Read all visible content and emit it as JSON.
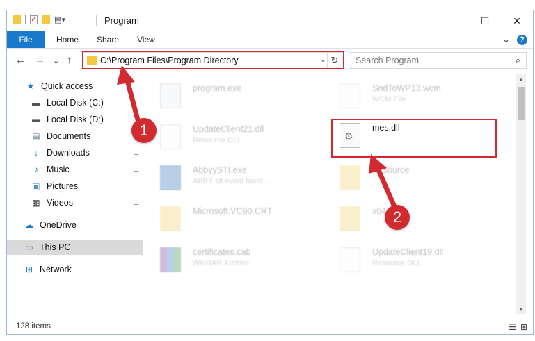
{
  "window": {
    "title": "Program",
    "controls": {
      "minimize": "—",
      "maximize": "☐",
      "close": "✕"
    }
  },
  "ribbon": {
    "tabs": [
      "File",
      "Home",
      "Share",
      "View"
    ],
    "expand_icon": "⌄",
    "help_label": "?"
  },
  "address_bar": {
    "path": "C:\\Program Files\\Program Directory",
    "dropdown": "⌄",
    "refresh": "↻"
  },
  "search": {
    "placeholder": "Search Program",
    "icon": "⌕"
  },
  "navigation": {
    "back": "←",
    "forward": "→",
    "recent": "⌄",
    "up": "↑"
  },
  "sidebar": {
    "items": [
      {
        "label": "Quick access",
        "icon": "★",
        "pinned": false
      },
      {
        "label": "Local Disk (C:)",
        "icon": "▬",
        "pinned": true
      },
      {
        "label": "Local Disk (D:)",
        "icon": "▬",
        "pinned": true
      },
      {
        "label": "Documents",
        "icon": "▤",
        "pinned": true
      },
      {
        "label": "Downloads",
        "icon": "↓",
        "pinned": true
      },
      {
        "label": "Music",
        "icon": "♪",
        "pinned": true
      },
      {
        "label": "Pictures",
        "icon": "▣",
        "pinned": true
      },
      {
        "label": "Videos",
        "icon": "▦",
        "pinned": true
      },
      {
        "label": "OneDrive",
        "icon": "☁",
        "pinned": false
      },
      {
        "label": "This PC",
        "icon": "▭",
        "pinned": false
      },
      {
        "label": "Network",
        "icon": "⊞",
        "pinned": false
      }
    ],
    "pin_icon": "📌"
  },
  "files": [
    {
      "name": "program.exe",
      "type": "",
      "kind": "exe"
    },
    {
      "name": "SndToWP13.wcm",
      "type": "WCM File",
      "kind": "doc"
    },
    {
      "name": "UpdateClient21.dll",
      "type": "Resource DLL",
      "kind": "dll"
    },
    {
      "name": "mes.dll",
      "type": "",
      "kind": "dll"
    },
    {
      "name": "AbbyySTI.exe",
      "type": "ABBY sti event hand...",
      "kind": "exe"
    },
    {
      "name": "Resource",
      "type": "",
      "kind": "folder"
    },
    {
      "name": "Microsoft.VC90.CRT",
      "type": "",
      "kind": "folder"
    },
    {
      "name": "x64",
      "type": "",
      "kind": "folder"
    },
    {
      "name": "certificates.cab",
      "type": "WinRAR Archive",
      "kind": "archive"
    },
    {
      "name": "UpdateClient19.dll",
      "type": "Resource DLL",
      "kind": "dll"
    }
  ],
  "annotations": {
    "step1": "1",
    "step2": "2"
  },
  "status": {
    "count": "128 items"
  },
  "colors": {
    "accent": "#1979ca",
    "annotation": "#d12a2f",
    "selection": "#dadada"
  }
}
